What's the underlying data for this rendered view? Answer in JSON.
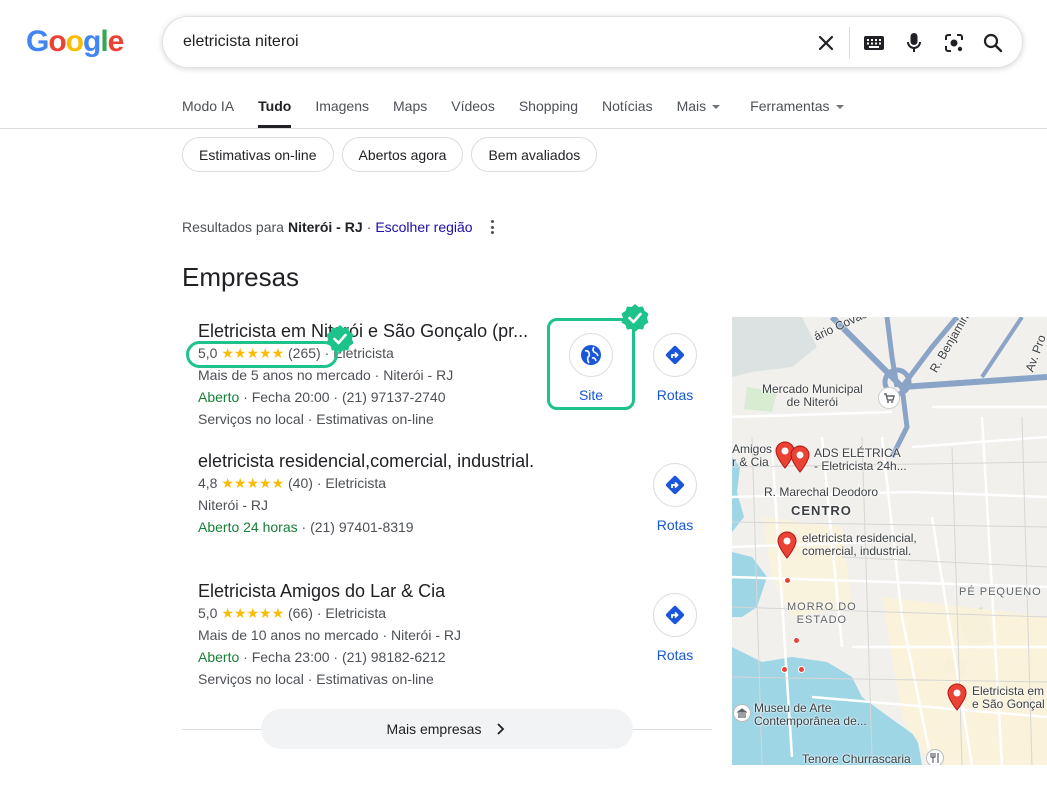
{
  "logo": {
    "letters": [
      "G",
      "o",
      "o",
      "g",
      "l",
      "e"
    ],
    "colors": [
      "#4285F4",
      "#EA4335",
      "#FBBC05",
      "#4285F4",
      "#34A853",
      "#EA4335"
    ]
  },
  "search": {
    "query": "eletricista niteroi"
  },
  "tabs": [
    {
      "label": "Modo IA"
    },
    {
      "label": "Tudo",
      "active": true
    },
    {
      "label": "Imagens"
    },
    {
      "label": "Maps"
    },
    {
      "label": "Vídeos"
    },
    {
      "label": "Shopping"
    },
    {
      "label": "Notícias"
    },
    {
      "label": "Mais"
    },
    {
      "label": "Ferramentas"
    }
  ],
  "chips": [
    "Estimativas on-line",
    "Abertos agora",
    "Bem avaliados"
  ],
  "region": {
    "prefix": "Resultados para",
    "place": "Niterói - RJ",
    "sep": "·",
    "link": "Escolher região"
  },
  "section_title": "Empresas",
  "businesses": [
    {
      "name": "Eletricista em Niterói e São Gonçalo (pr...",
      "rating": "5,0",
      "stars": "★★★★★",
      "reviews": "(265)",
      "category": "· Eletricista",
      "line2": "Mais de 5 anos no mercado · Niterói - RJ",
      "status": "Aberto",
      "line3_rest": " · Fecha 20:00 · (21) 97137-2740",
      "line4": "Serviços no local · Estimativas on-line"
    },
    {
      "name": "eletricista residencial,comercial, industrial.",
      "rating": "4,8",
      "stars": "★★★★★",
      "reviews": "(40)",
      "category": "· Eletricista",
      "line2": "Niterói - RJ",
      "status": "Aberto 24 horas",
      "line3_rest": " · (21) 97401-8319",
      "line4": ""
    },
    {
      "name": "Eletricista Amigos do Lar & Cia",
      "rating": "5,0",
      "stars": "★★★★★",
      "reviews": "(66)",
      "category": "· Eletricista",
      "line2": "Mais de 10 anos no mercado · Niterói - RJ",
      "status": "Aberto",
      "line3_rest": " · Fecha 23:00 · (21) 98182-6212",
      "line4": "Serviços no local · Estimativas on-line"
    }
  ],
  "actions": {
    "site": "Site",
    "rotas": "Rotas"
  },
  "more_button": "Mais empresas",
  "map": {
    "labels": {
      "mercado": "Mercado Municipal\nde Niterói",
      "amigos": "Amigos\nr & Cia",
      "ads": "ADS ELÉTRICA\n- Eletricista 24h...",
      "marechal": "R. Marechal Deodoro",
      "centro": "CENTRO",
      "residencial": "eletricista residencial,\ncomercial, industrial.",
      "morro": "MORRO DO\nESTADO",
      "pequeno": "PÉ PEQUENO",
      "eletricista_sg": "Eletricista em\ne São Gonçal",
      "museu": "Museu de Arte\nContemporânea de...",
      "tenore": "Tenore Churrascaria",
      "covas": "ário Covas",
      "benjamin": "R. Benjamin",
      "av": "Av. Pro"
    }
  }
}
